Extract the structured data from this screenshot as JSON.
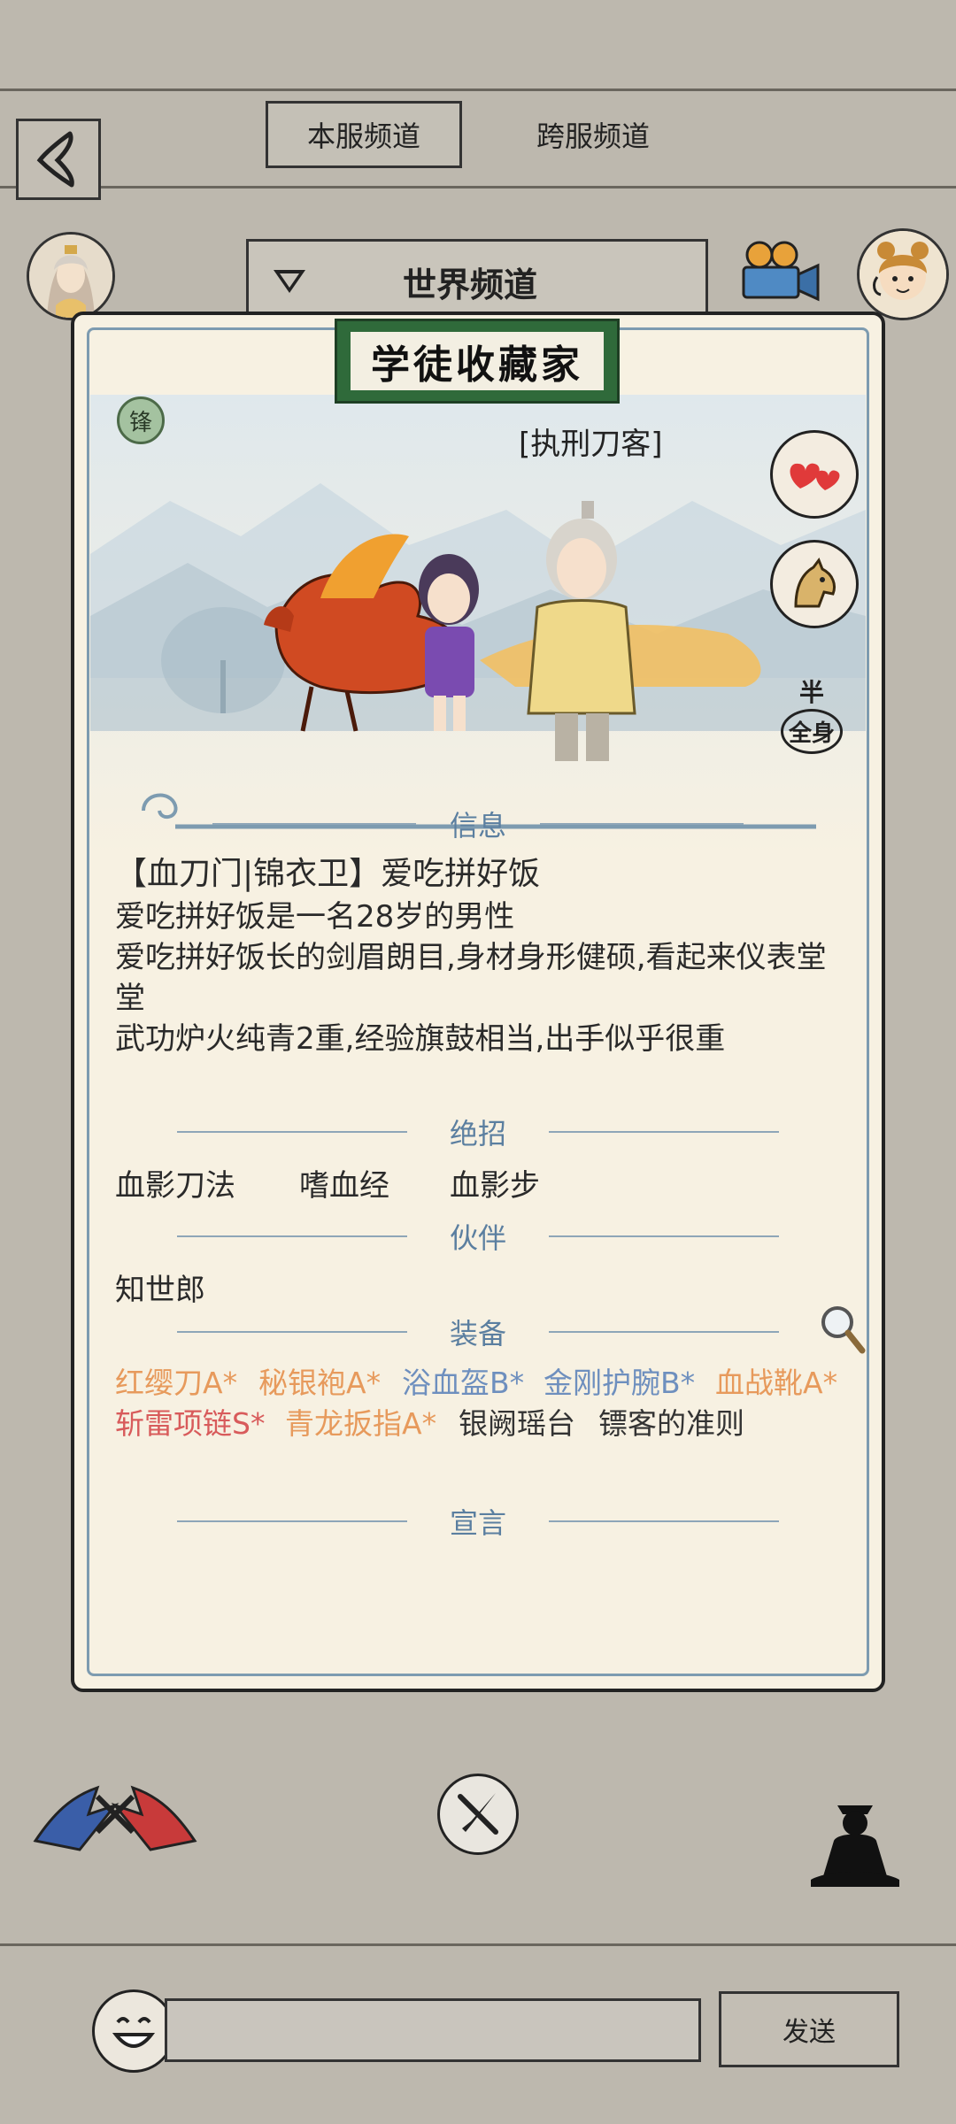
{
  "tabs": {
    "local": "本服频道",
    "cross": "跨服频道"
  },
  "channel": {
    "label": "世界频道"
  },
  "card": {
    "title": "学徒收藏家",
    "rank_badge": "锋",
    "nickname_tag": "[执刑刀客]",
    "mode_badge": {
      "top": "半",
      "bottom": "全身"
    }
  },
  "info": {
    "heading": "信息",
    "header_line": "【血刀门|锦衣卫】爱吃拼好饭",
    "lines": [
      "爱吃拼好饭是一名28岁的男性",
      "爱吃拼好饭长的剑眉朗目,身材身形健硕,看起来仪表堂",
      "堂",
      "武功炉火纯青2重,经验旗鼓相当,出手似乎很重"
    ]
  },
  "skills": {
    "heading": "绝招",
    "items": [
      "血影刀法",
      "嗜血经",
      "血影步"
    ]
  },
  "partner": {
    "heading": "伙伴",
    "name": "知世郎"
  },
  "equipment": {
    "heading": "装备",
    "row1": [
      {
        "name": "红缨刀A*",
        "color": "#e79a5c"
      },
      {
        "name": "秘银袍A*",
        "color": "#e79a5c"
      },
      {
        "name": "浴血盔B*",
        "color": "#6e8fbe"
      },
      {
        "name": "金刚护腕B*",
        "color": "#6e8fbe"
      },
      {
        "name": "血战靴A*",
        "color": "#e79a5c"
      }
    ],
    "row2": [
      {
        "name": "斩雷项链S*",
        "color": "#d85b5b"
      },
      {
        "name": "青龙扳指A*",
        "color": "#e79a5c"
      },
      {
        "name": "银阙瑶台",
        "color": "#333333"
      },
      {
        "name": "镖客的准则",
        "color": "#333333"
      }
    ]
  },
  "declaration": {
    "heading": "宣言"
  },
  "input": {
    "placeholder": "",
    "send_label": "发送"
  },
  "icons": {
    "back": "back-arrow-icon",
    "camera": "movie-camera-icon",
    "search": "magnifier-icon",
    "pk": "duel-icon",
    "close": "crossed-swords-close-icon",
    "meditate": "meditation-icon",
    "emoji": "laughing-face-icon"
  }
}
